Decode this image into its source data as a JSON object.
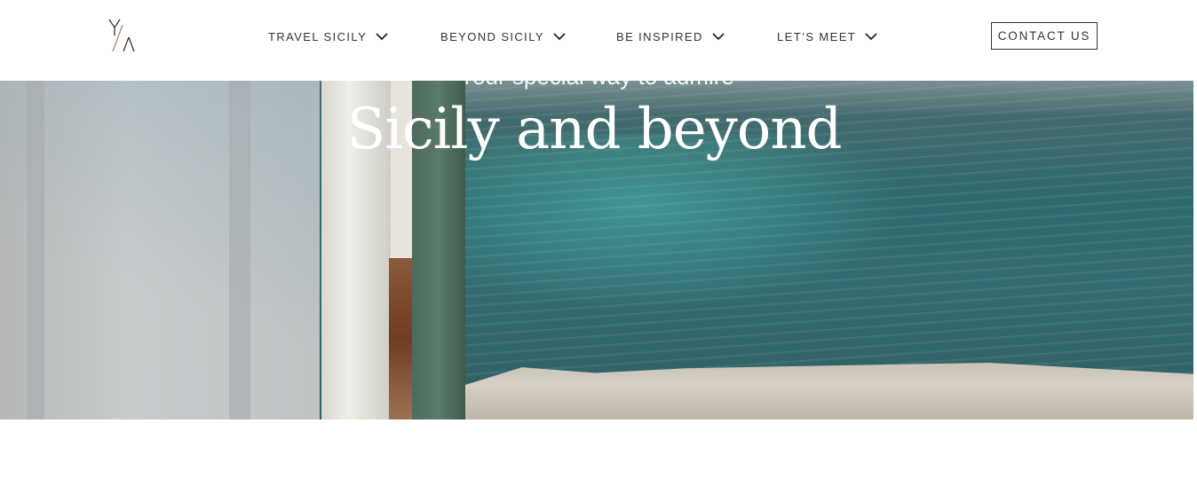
{
  "header": {
    "logo_text": "Y/A",
    "nav": [
      {
        "label": "TRAVEL SICILY"
      },
      {
        "label": "BEYOND SICILY"
      },
      {
        "label": "BE INSPIRED"
      },
      {
        "label": "LET’S MEET"
      }
    ],
    "contact_label": "CONTACT US"
  },
  "hero": {
    "subtitle": "Your special way to admire",
    "title": "Sicily and beyond"
  },
  "colors": {
    "text_dark": "#333333",
    "logo_accent": "#b08a6a",
    "hero_water": "#2e6a6d"
  }
}
